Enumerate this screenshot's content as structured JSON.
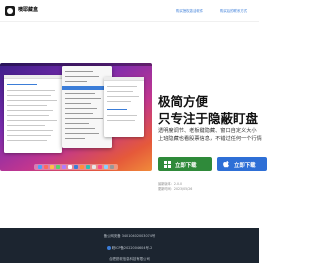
{
  "header": {
    "app_name": "噢耶藏盒",
    "nav": [
      {
        "label": "购买授权激活软件"
      },
      {
        "label": "购买后的联系方式"
      }
    ]
  },
  "hero": {
    "title_line1": "极简方便",
    "title_line2": "只专注于隐蔽盯盘",
    "desc_line1": "透明度调节、老板键隐藏、窗口自定义大小",
    "desc_line2": "上班隐藏也看股票信息，不错过任何一个行情",
    "buttons": {
      "windows": "立即下载",
      "mac": "立即下载"
    },
    "meta": {
      "version": "最新版本：2.0.0",
      "updated": "更新时间：2023/05/26"
    }
  },
  "footer": {
    "line1": "备公网安备 34010402003074号",
    "line2": "皖ICP备2022004604号-2",
    "line3": "合肥锐软信息科技有限公司"
  },
  "colors": {
    "accent_blue": "#2e6fd6",
    "windows_green": "#2f8a3a",
    "footer_bg": "#1c2530"
  },
  "icons": [
    "app-logo-icon",
    "windows-icon",
    "apple-icon",
    "police-badge-icon"
  ]
}
